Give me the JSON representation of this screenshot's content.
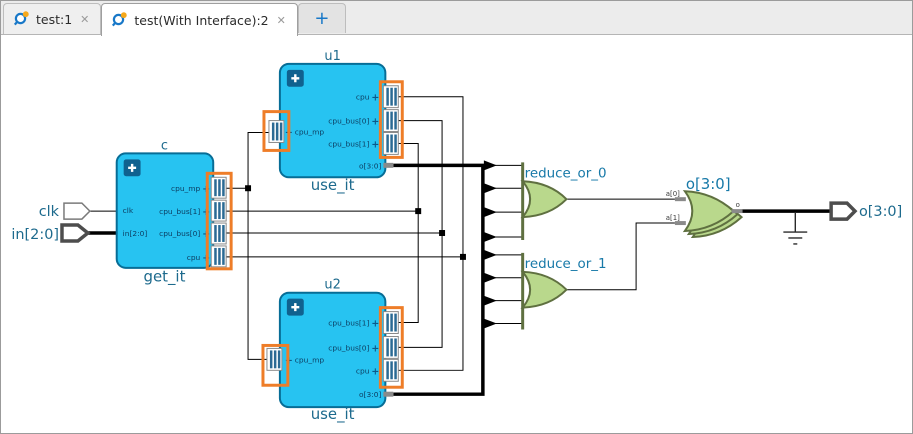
{
  "tab_bar": {
    "tabs": [
      {
        "label": "test:1",
        "active": false
      },
      {
        "label": "test(With Interface):2",
        "active": true
      }
    ],
    "new_tab_label": "+",
    "close_glyph": "✕"
  },
  "icons": {
    "pin_plus": "+"
  },
  "schematic": {
    "blocks": [
      {
        "title": "c",
        "instance": "get_it",
        "left_pins": [
          "clk",
          "in[2:0]"
        ],
        "right_pins": [
          "cpu_mp",
          "cpu_bus[1]",
          "cpu_bus[0]",
          "cpu"
        ]
      },
      {
        "title": "u1",
        "instance": "use_it",
        "left_pins": [
          "cpu_mp"
        ],
        "right_pins": [
          "cpu",
          "cpu_bus[0]",
          "cpu_bus[1]",
          "o[3:0]"
        ]
      },
      {
        "title": "u2",
        "instance": "use_it",
        "left_pins": [
          "cpu_mp"
        ],
        "right_pins": [
          "cpu_bus[1]",
          "cpu_bus[0]",
          "cpu",
          "o[3:0]"
        ]
      }
    ],
    "or_gates": [
      {
        "name": "reduce_or_0"
      },
      {
        "name": "reduce_or_1"
      }
    ],
    "output_gate": {
      "name": "o[3:0]",
      "inputs": [
        "a[0]",
        "a[1]"
      ],
      "output": "o"
    },
    "ports": {
      "clk": "clk",
      "data_in": "in[2:0]",
      "data_out": "o[3:0]"
    },
    "colors": {
      "block_fill": "#27c3f1",
      "block_border": "#076d96",
      "gate_fill": "#b9d88c",
      "gate_border": "#5f7040",
      "highlight_orange": "#ee7d28",
      "net": "#000000",
      "label_teal": "#1d6a8d"
    }
  }
}
